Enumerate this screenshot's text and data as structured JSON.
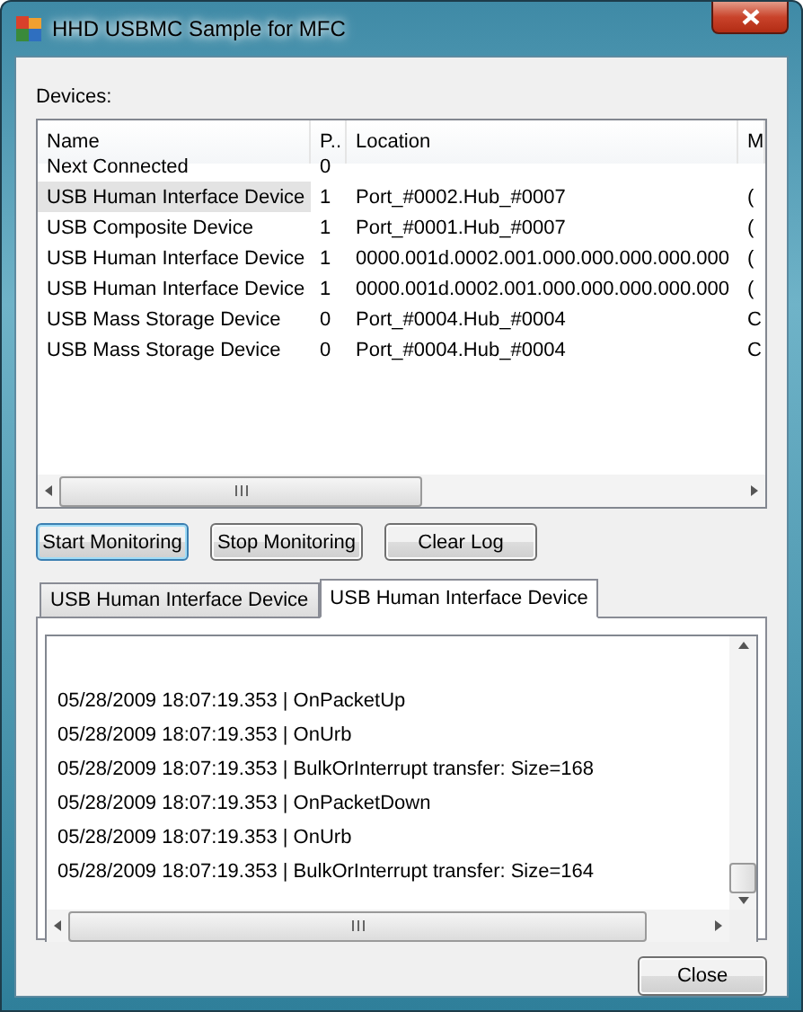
{
  "window": {
    "title": "HHD USBMC Sample for MFC"
  },
  "devices_label": "Devices:",
  "device_table": {
    "columns": [
      "Name",
      "P..",
      "Location",
      "M"
    ],
    "rows": [
      {
        "cells": [
          "Next Connected",
          "0",
          "",
          ""
        ],
        "selected": false
      },
      {
        "cells": [
          "USB Human Interface Device",
          "1",
          "Port_#0002.Hub_#0007",
          "("
        ],
        "selected": true
      },
      {
        "cells": [
          "USB Composite Device",
          "1",
          "Port_#0001.Hub_#0007",
          "("
        ],
        "selected": false
      },
      {
        "cells": [
          "USB Human Interface Device",
          "1",
          "0000.001d.0002.001.000.000.000.000.000",
          "("
        ],
        "selected": false
      },
      {
        "cells": [
          "USB Human Interface Device",
          "1",
          "0000.001d.0002.001.000.000.000.000.000",
          "("
        ],
        "selected": false
      },
      {
        "cells": [
          "USB Mass Storage Device",
          "0",
          "Port_#0004.Hub_#0004",
          "C"
        ],
        "selected": false
      },
      {
        "cells": [
          "USB Mass Storage Device",
          "0",
          "Port_#0004.Hub_#0004",
          "C"
        ],
        "selected": false
      }
    ]
  },
  "buttons": [
    {
      "label": "Start Monitoring",
      "focused": true
    },
    {
      "label": "Stop Monitoring",
      "focused": false
    },
    {
      "label": "Clear Log",
      "focused": false
    }
  ],
  "tabs": [
    {
      "label": "USB Human Interface Device",
      "selected": false
    },
    {
      "label": "USB Human Interface Device",
      "selected": true
    }
  ],
  "log_lines": [
    "05/28/2009 18:07:19.353 | OnPacketUp",
    "05/28/2009 18:07:19.353 | OnUrb",
    "05/28/2009 18:07:19.353 | BulkOrInterrupt transfer: Size=168",
    "05/28/2009 18:07:19.353 | OnPacketDown",
    "05/28/2009 18:07:19.353 | OnUrb",
    "05/28/2009 18:07:19.353 | BulkOrInterrupt transfer: Size=164"
  ],
  "close_button": "Close"
}
